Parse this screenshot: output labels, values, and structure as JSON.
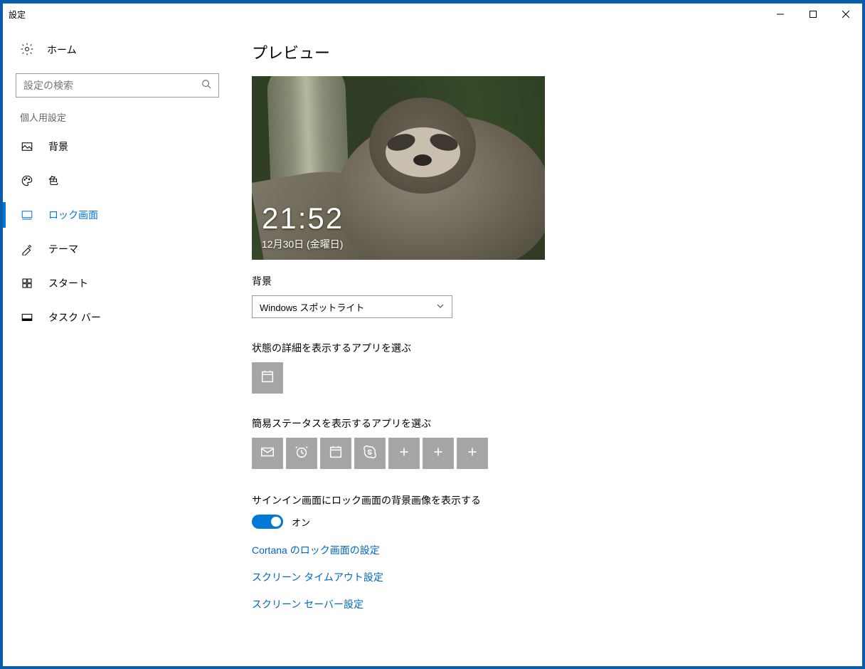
{
  "window": {
    "title": "設定"
  },
  "sidebar": {
    "home": "ホーム",
    "searchPlaceholder": "設定の検索",
    "sectionLabel": "個人用設定",
    "items": [
      {
        "label": "背景"
      },
      {
        "label": "色"
      },
      {
        "label": "ロック画面"
      },
      {
        "label": "テーマ"
      },
      {
        "label": "スタート"
      },
      {
        "label": "タスク バー"
      }
    ]
  },
  "main": {
    "heading": "プレビュー",
    "previewTime": "21:52",
    "previewDate": "12月30日 (金曜日)",
    "backgroundLabel": "背景",
    "backgroundDropdown": "Windows スポットライト",
    "detailedAppLabel": "状態の詳細を表示するアプリを選ぶ",
    "quickAppLabel": "簡易ステータスを表示するアプリを選ぶ",
    "signinBgLabel": "サインイン画面にロック画面の背景画像を表示する",
    "toggleState": "オン",
    "links": [
      "Cortana のロック画面の設定",
      "スクリーン タイムアウト設定",
      "スクリーン セーバー設定"
    ]
  }
}
